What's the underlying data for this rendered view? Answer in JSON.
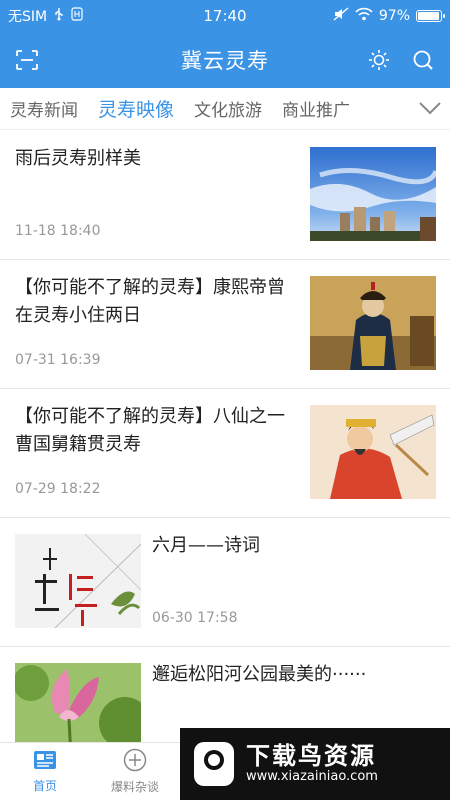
{
  "status_bar": {
    "carrier": "无SIM",
    "time": "17:40",
    "battery": "97%",
    "battery_level": 0.97
  },
  "header": {
    "title": "冀云灵寿",
    "left_icon": "scan-icon",
    "right_icons": [
      "brightness-icon",
      "search-icon"
    ]
  },
  "tabs": {
    "items": [
      {
        "label": "灵寿新闻",
        "active": false
      },
      {
        "label": "灵寿映像",
        "active": true
      },
      {
        "label": "文化旅游",
        "active": false
      },
      {
        "label": "商业推广",
        "active": false
      }
    ],
    "more_icon": "chevron-down-icon"
  },
  "articles": [
    {
      "title": "雨后灵寿别样美",
      "date": "11-18 18:40",
      "layout": "image-right"
    },
    {
      "title": "【你可能不了解的灵寿】康熙帝曾在灵寿小住两日",
      "date": "07-31 16:39",
      "layout": "image-right"
    },
    {
      "title": "【你可能不了解的灵寿】八仙之一曹国舅籍贯灵寿",
      "date": "07-29 18:22",
      "layout": "image-right"
    },
    {
      "title": "六月——诗词",
      "date": "06-30 17:58",
      "layout": "image-left",
      "thumb_text": "毛尖上的诗词"
    },
    {
      "title": "邂逅松阳河公园最美的······",
      "date": "",
      "layout": "image-left"
    }
  ],
  "bottom_nav": {
    "items": [
      {
        "label": "首页",
        "icon": "home-news-icon",
        "active": true
      },
      {
        "label": "爆料杂谈",
        "icon": "plus-circle-icon",
        "active": false
      }
    ]
  },
  "watermark": {
    "name": "下载鸟资源",
    "url": "www.xiazainiao.com"
  },
  "colors": {
    "primary": "#3b93e6",
    "text": "#222222",
    "muted": "#999999"
  }
}
